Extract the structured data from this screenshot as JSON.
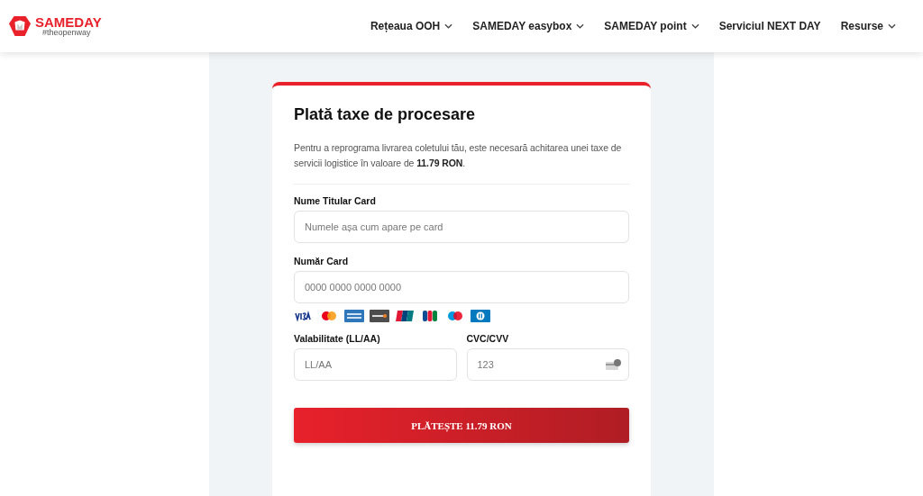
{
  "logo": {
    "name": "SAMEDAY",
    "tagline": "#theopenway"
  },
  "nav": [
    {
      "label": "Rețeaua OOH",
      "has_menu": true
    },
    {
      "label": "SAMEDAY easybox",
      "has_menu": true
    },
    {
      "label": "SAMEDAY point",
      "has_menu": true
    },
    {
      "label": "Serviciul NEXT DAY",
      "has_menu": false
    },
    {
      "label": "Resurse",
      "has_menu": true
    }
  ],
  "form": {
    "title": "Plată taxe de procesare",
    "intro": "Pentru a reprograma livrarea coletului tău, este necesară achitarea unei taxe de servicii logistice în valoare de **11.79 RON**.",
    "fields": [
      {
        "kind": "text",
        "label": "Nume Titular Card",
        "placeholder": "Numele așa cum apare pe card"
      },
      {
        "kind": "card_number",
        "label": "Număr Card",
        "placeholder": "0000 0000 0000 0000"
      }
    ],
    "row_fields": [
      {
        "kind": "text",
        "label": "Valabilitate (LL/AA)",
        "placeholder": "LL/AA"
      },
      {
        "kind": "cvc",
        "label": "CVC/CVV",
        "placeholder": "123"
      }
    ],
    "button": "PLĂTEȘTE 11.79 RON"
  }
}
